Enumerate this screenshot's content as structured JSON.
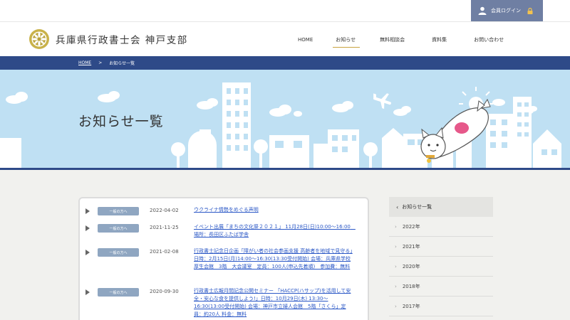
{
  "topbar": {
    "login_label": "会員ログイン"
  },
  "header": {
    "site_title": "兵庫県行政書士会 神戸支部"
  },
  "nav": {
    "items": [
      {
        "label": "HOME"
      },
      {
        "label": "お知らせ"
      },
      {
        "label": "無料相談会"
      },
      {
        "label": "資料集"
      },
      {
        "label": "お問い合わせ"
      }
    ],
    "active_index": 1
  },
  "breadcrumb": {
    "home": "HOME",
    "separator": ">",
    "current": "お知らせ一覧"
  },
  "hero": {
    "title": "お知らせ一覧"
  },
  "news": {
    "items": [
      {
        "badge": "一般の方へ",
        "date": "2022-04-02",
        "title": "ウクライナ情勢をめぐる声明"
      },
      {
        "badge": "一般の方へ",
        "date": "2021-11-25",
        "title": "イベント出展「まちの文化祭２０２１」 11月28日(日)10:00〜16:00　場所：長田区ふたば学舎"
      },
      {
        "badge": "一般の方へ",
        "date": "2021-02-08",
        "title": "行政書士記念日企画「障がい者の社会参画支援 高齢者を地域で見守る」日時：2月15日(月)14:00〜16:30(13:30受付開始) 会場：兵庫県学校厚生会館　3階　大会議室　定員：100人(申込先着順)　参加費：無料"
      },
      {
        "badge": "一般の方へ",
        "date": "2020-09-30",
        "title": "行政書士広報月間記念公開セミナー 「HACCP(ハサップ)を活用して安全・安心な食を提供しよう!」日時：10月29日(木) 13:30〜16:30(13:00受付開始) 会場：神戸市立婦人会館　5階「さくら」定員：約20人 料金：無料"
      }
    ]
  },
  "sidebar": {
    "heading": "お知らせ一覧",
    "years": [
      "2022年",
      "2021年",
      "2020年",
      "2018年",
      "2017年"
    ]
  },
  "colors": {
    "navy": "#2e4a88",
    "login_bg": "#6f7fa3",
    "badge": "#8fa6c1",
    "link": "#2a57c6",
    "sky": "#bfe0f3",
    "gold": "#c9a340"
  },
  "icons": [
    "user-icon",
    "lock-icon",
    "logo-emblem",
    "airplane-icon",
    "sun-icon"
  ]
}
